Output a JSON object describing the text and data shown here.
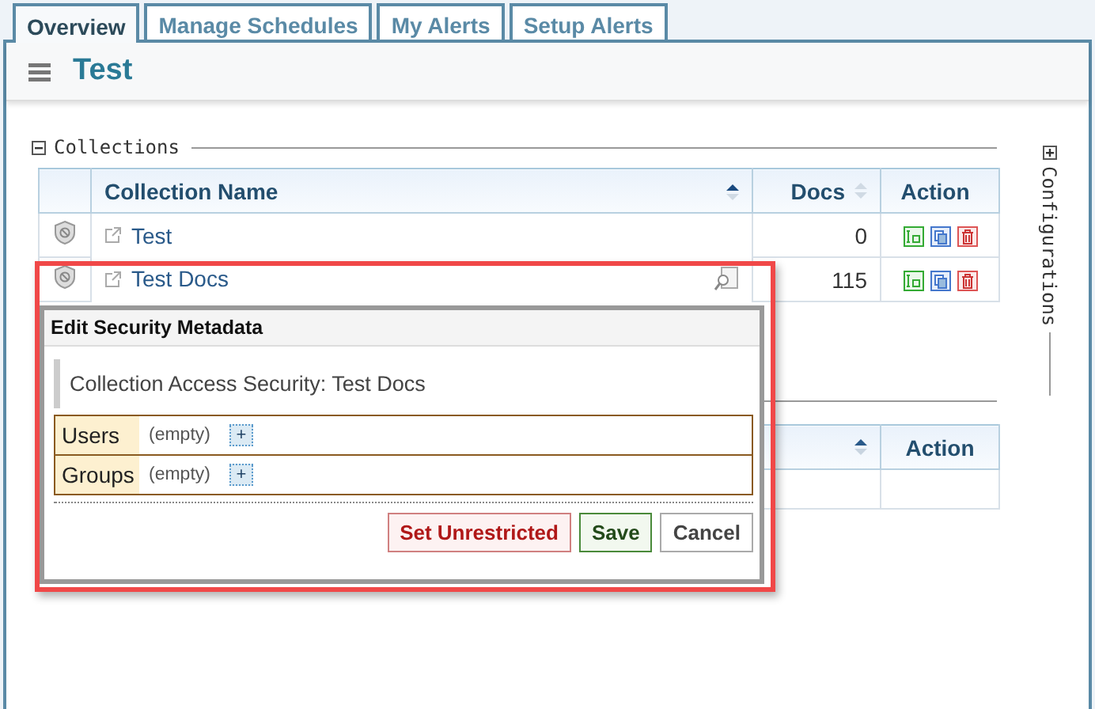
{
  "tabs": [
    {
      "label": "Overview",
      "selected": true
    },
    {
      "label": "Manage Schedules",
      "selected": false
    },
    {
      "label": "My Alerts",
      "selected": false
    },
    {
      "label": "Setup Alerts",
      "selected": false
    }
  ],
  "page_title": "Test",
  "collections": {
    "title": "Collections",
    "expanded": true,
    "columns": [
      {
        "label": "Collection Name",
        "sortable": true,
        "sorted": true
      },
      {
        "label": "Docs",
        "sortable": true,
        "sorted": false
      },
      {
        "label": "Action",
        "sortable": false
      }
    ],
    "rows": [
      {
        "name": "Test",
        "docs": "0",
        "hovered": false
      },
      {
        "name": "Test Docs",
        "docs": "115",
        "hovered": true
      }
    ]
  },
  "second_table": {
    "columns": [
      {
        "label": "Action"
      }
    ]
  },
  "side_panel": {
    "label": "Configurations",
    "expanded": false
  },
  "popup": {
    "title": "Edit Security Metadata",
    "heading": "Collection Access Security: Test Docs",
    "fields": [
      {
        "label": "Users",
        "value": "(empty)",
        "add": "+"
      },
      {
        "label": "Groups",
        "value": "(empty)",
        "add": "+"
      }
    ],
    "buttons": [
      {
        "label": "Set Unrestricted",
        "kind": "danger"
      },
      {
        "label": "Save",
        "kind": "primary"
      },
      {
        "label": "Cancel",
        "kind": "default"
      }
    ]
  }
}
